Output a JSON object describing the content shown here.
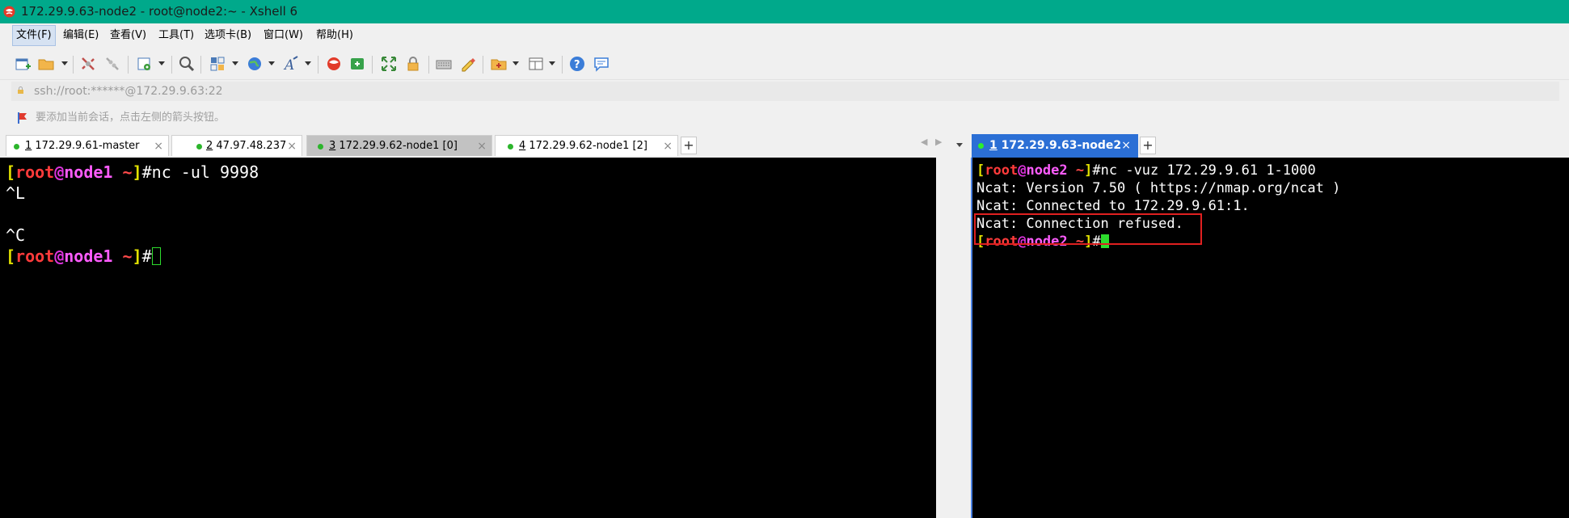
{
  "window": {
    "title": "172.29.9.63-node2 - root@node2:~ - Xshell 6"
  },
  "menu": {
    "items": [
      "文件(F)",
      "编辑(E)",
      "查看(V)",
      "工具(T)",
      "选项卡(B)",
      "窗口(W)",
      "帮助(H)"
    ]
  },
  "address": {
    "value": "ssh://root:******@172.29.9.63:22"
  },
  "hint": {
    "text": "要添加当前会话，点击左侧的箭头按钮。"
  },
  "tabs_left": [
    {
      "num": "1",
      "label": " 172.29.9.61-master",
      "status_color": "#2cb52c"
    },
    {
      "num": "2",
      "label": " 47.97.48.237",
      "status_color": "#2cb52c"
    },
    {
      "num": "3",
      "label": " 172.29.9.62-node1 [0]",
      "status_color": "#2cb52c"
    },
    {
      "num": "4",
      "label": " 172.29.9.62-node1 [2]",
      "status_color": "#2cb52c"
    }
  ],
  "tabs_right": [
    {
      "num": "1",
      "label": " 172.29.9.63-node2",
      "status_color": "#2cf02c"
    }
  ],
  "terminal_left": {
    "prompt_user": "root",
    "prompt_host": "node1",
    "lines": {
      "cmd": "#nc -ul 9998",
      "l2": "^L",
      "l3": "",
      "l4": "^C",
      "last": "#"
    }
  },
  "terminal_right": {
    "prompt_user": "root",
    "prompt_host": "node2",
    "lines": {
      "cmd": "#nc -vuz 172.29.9.61 1-1000",
      "version": "Ncat: Version 7.50 ( https://nmap.org/ncat )",
      "connected": "Ncat: Connected to 172.29.9.61:1.",
      "refused": "Ncat: Connection refused.",
      "last": "#"
    }
  },
  "colors": {
    "titlebar": "#00a98b",
    "active_tab": "#2b6fd5",
    "highlight_box": "#e02020",
    "cursor": "#2ddc2d"
  }
}
